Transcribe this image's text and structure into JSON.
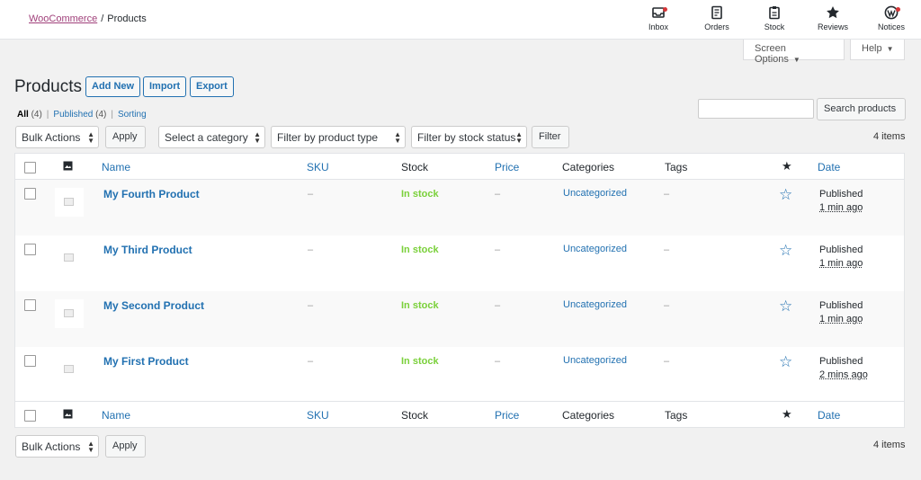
{
  "header": {
    "breadcrumb_root": "WooCommerce",
    "breadcrumb_sep": "/",
    "breadcrumb_current": "Products",
    "activity": [
      {
        "label": "Inbox",
        "icon": "inbox-icon",
        "dot": true
      },
      {
        "label": "Orders",
        "icon": "orders-icon",
        "dot": false
      },
      {
        "label": "Stock",
        "icon": "stock-icon",
        "dot": false
      },
      {
        "label": "Reviews",
        "icon": "star-icon",
        "dot": false
      },
      {
        "label": "Notices",
        "icon": "wordpress-icon",
        "dot": true
      }
    ]
  },
  "screen_options": {
    "label": "Screen Options",
    "arrow": "▼"
  },
  "help": {
    "label": "Help",
    "arrow": "▼"
  },
  "page": {
    "title": "Products",
    "add_new": "Add New",
    "import": "Import",
    "export": "Export"
  },
  "filters_links": {
    "all": "All",
    "all_count": "(4)",
    "published": "Published",
    "published_count": "(4)",
    "sorting": "Sorting",
    "separator": "|"
  },
  "search": {
    "placeholder": "",
    "button": "Search products"
  },
  "tablenav_top": {
    "bulk_actions": "Bulk Actions",
    "apply": "Apply",
    "category": "Select a category",
    "product_type": "Filter by product type",
    "stock_status": "Filter by stock status",
    "filter": "Filter",
    "items": "4 items"
  },
  "columns": {
    "name": "Name",
    "sku": "SKU",
    "stock": "Stock",
    "price": "Price",
    "categories": "Categories",
    "tags": "Tags",
    "date": "Date"
  },
  "products": [
    {
      "name": "My Fourth Product",
      "sku": "–",
      "stock": "In stock",
      "price": "–",
      "category": "Uncategorized",
      "tags": "–",
      "status": "Published",
      "ago": "1 min ago"
    },
    {
      "name": "My Third Product",
      "sku": "–",
      "stock": "In stock",
      "price": "–",
      "category": "Uncategorized",
      "tags": "–",
      "status": "Published",
      "ago": "1 min ago"
    },
    {
      "name": "My Second Product",
      "sku": "–",
      "stock": "In stock",
      "price": "–",
      "category": "Uncategorized",
      "tags": "–",
      "status": "Published",
      "ago": "1 min ago"
    },
    {
      "name": "My First Product",
      "sku": "–",
      "stock": "In stock",
      "price": "–",
      "category": "Uncategorized",
      "tags": "–",
      "status": "Published",
      "ago": "2 mins ago"
    }
  ],
  "tablenav_bottom": {
    "bulk_actions": "Bulk Actions",
    "apply": "Apply",
    "items": "4 items"
  },
  "colors": {
    "link": "#2271b1",
    "in_stock": "#7ad03a",
    "woo": "#a0407a"
  }
}
